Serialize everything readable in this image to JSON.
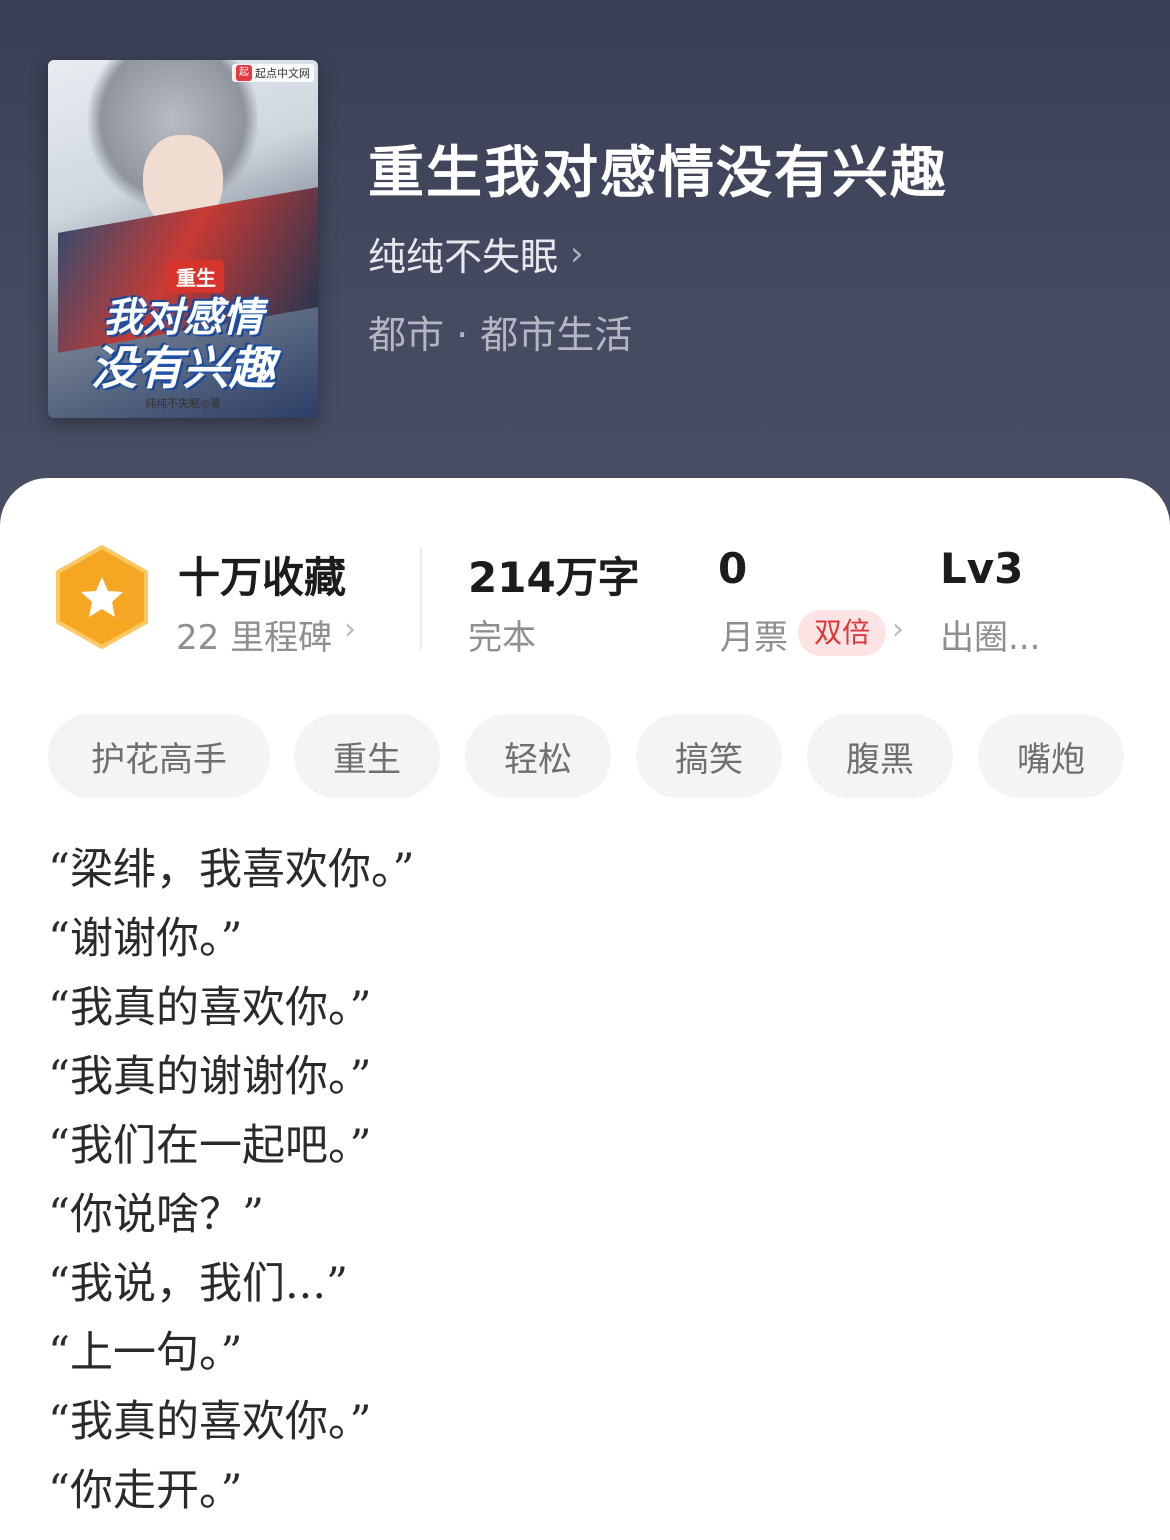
{
  "book": {
    "title": "重生我对感情没有兴趣",
    "author": "纯纯不失眠",
    "genre": "都市 · 都市生活"
  },
  "cover": {
    "publisher_mark": "起",
    "publisher": "起点中文网",
    "tag": "重生",
    "line1": "我对感情",
    "line2": "没有兴趣",
    "author_credit": "纯纯不失眠◎著"
  },
  "stats": {
    "favorites": {
      "value": "十万收藏",
      "sub": "22 里程碑"
    },
    "words": {
      "value": "214万字",
      "sub": "完本"
    },
    "monthly_ticket": {
      "value": "0",
      "sub": "月票",
      "badge": "双倍"
    },
    "level": {
      "value": "Lv3",
      "sub": "出圈..."
    }
  },
  "tags": [
    "护花高手",
    "重生",
    "轻松",
    "搞笑",
    "腹黑",
    "嘴炮"
  ],
  "description": [
    "“梁绯，我喜欢你。”",
    "“谢谢你。”",
    "“我真的喜欢你。”",
    "“我真的谢谢你。”",
    "“我们在一起吧。”",
    "“你说啥？”",
    "“我说，我们...”",
    "“上一句。”",
    "“我真的喜欢你。”",
    "“你走开。”"
  ],
  "colors": {
    "hero_bg": "#42475d",
    "badge_orange": "#f5a623",
    "double_pill": "#e0363a"
  }
}
